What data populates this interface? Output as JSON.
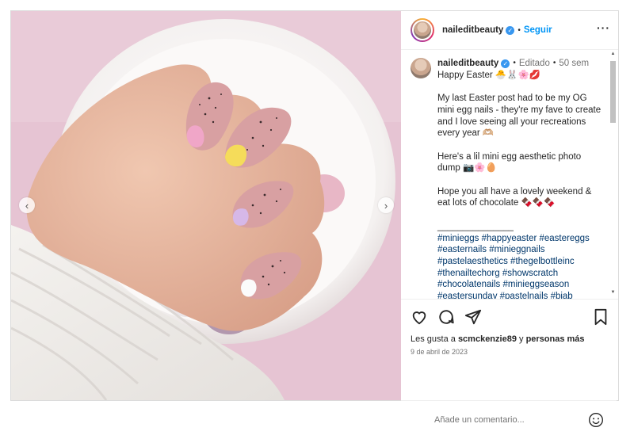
{
  "post": {
    "username": "naileditbeauty",
    "follow_label": "Seguir",
    "more_label": "···",
    "separator": "•"
  },
  "caption": {
    "username": "naileditbeauty",
    "edited": "Editado",
    "time_ago": "50 sem",
    "text": "Happy Easter 🐣🐰🌸💋\n\nMy last Easter post had to be my OG mini egg nails - they're my fave to create and I love seeing all your recreations every year 🫶🏼\n\nHere's a lil mini egg aesthetic photo dump 📷🌸🥚\n\nHope you all have a lovely weekend & eat lots of chocolate 🍫🍫🍫\n\n_______________",
    "hashtags": "#minieggs #happyeaster #eastereggs #easternails #minieggnails #pastelaesthetics #thegelbottleinc #thenailtechorg #showscratch #chocolatenails #minieggseason #eastersunday #pastelnails #biab"
  },
  "likes": {
    "prefix": "Les gusta a",
    "user": "scmckenzie89",
    "middle": "y",
    "others": "personas más"
  },
  "date": "9 de abril de 2023",
  "comment_input": {
    "placeholder": "Añade un comentario..."
  },
  "colors": {
    "accent": "#0095f6",
    "verified": "#3897f0",
    "hashtag": "#00376b",
    "background_pink": "#e8c9d6"
  },
  "icons": [
    "chevron-left-icon",
    "chevron-right-icon",
    "verified-icon",
    "more-icon",
    "heart-icon",
    "comment-icon",
    "share-icon",
    "bookmark-icon",
    "emoji-icon"
  ]
}
